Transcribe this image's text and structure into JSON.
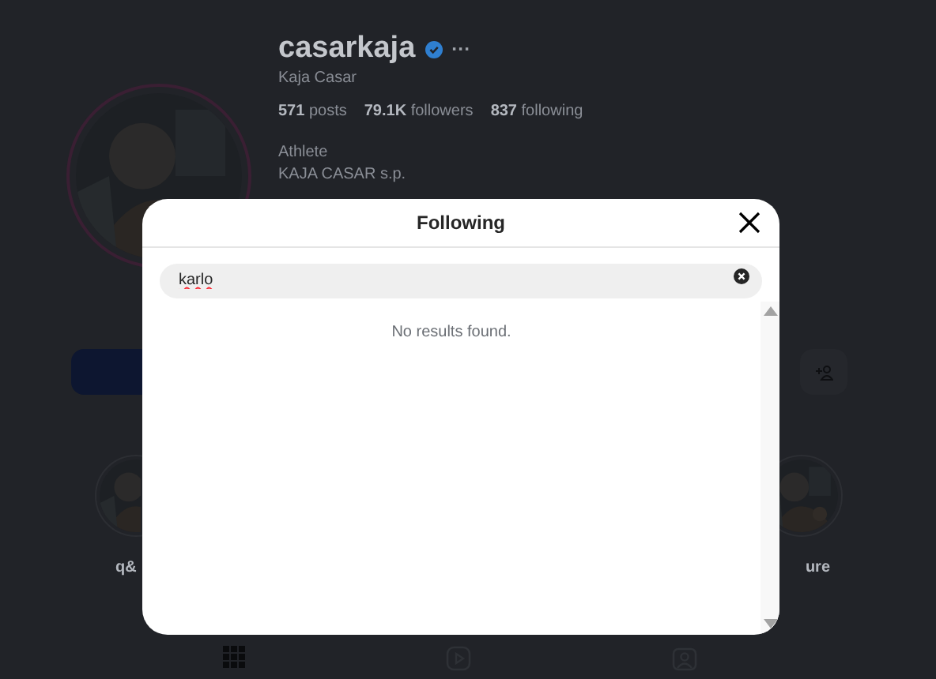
{
  "profile": {
    "username": "casarkaja",
    "verified": true,
    "more": "···",
    "full_name": "Kaja Casar",
    "stats": [
      {
        "count": "571",
        "label": "posts"
      },
      {
        "count": "79.1K",
        "label": "followers"
      },
      {
        "count": "837",
        "label": "following"
      }
    ],
    "category": "Athlete",
    "bio": "KAJA CASAR s.p."
  },
  "highlights": [
    {
      "label": "q&"
    },
    {
      "label": "ure"
    }
  ],
  "tabs": [
    {
      "kind": "grid",
      "selected": true
    },
    {
      "kind": "reels",
      "selected": false
    },
    {
      "kind": "tagged",
      "selected": false
    }
  ],
  "modal": {
    "title": "Following",
    "search": {
      "value": "karlo"
    },
    "message": "No results found."
  }
}
